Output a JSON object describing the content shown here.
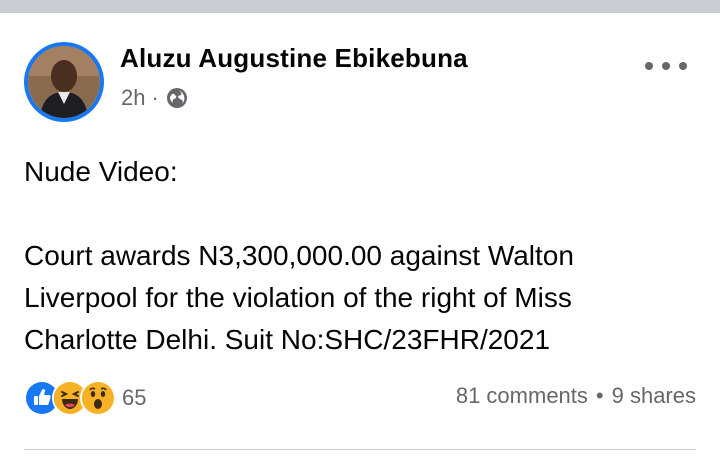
{
  "post": {
    "author": "Aluzu Augustine Ebikebuna",
    "time": "2h",
    "separator": "·",
    "privacy_icon": "globe-icon",
    "more_icon": "more-horizontal-icon",
    "text": {
      "line1": "Nude Video:",
      "body_lines": [
        "Court awards N3,300,000.00 against Walton",
        "Liverpool for the violation of the right of Miss",
        "Charlotte Delhi. Suit No:SHC/23FHR/2021"
      ]
    }
  },
  "footer": {
    "reactions": {
      "icons": [
        "like-icon",
        "haha-icon",
        "wow-icon"
      ],
      "count": "65"
    },
    "comments": "81 comments",
    "separator": "•",
    "shares": "9 shares"
  },
  "colors": {
    "accent": "#1877f2",
    "secondary_text": "#65676b",
    "primary_text": "#050505",
    "reaction_yellow": "#f7b125"
  }
}
